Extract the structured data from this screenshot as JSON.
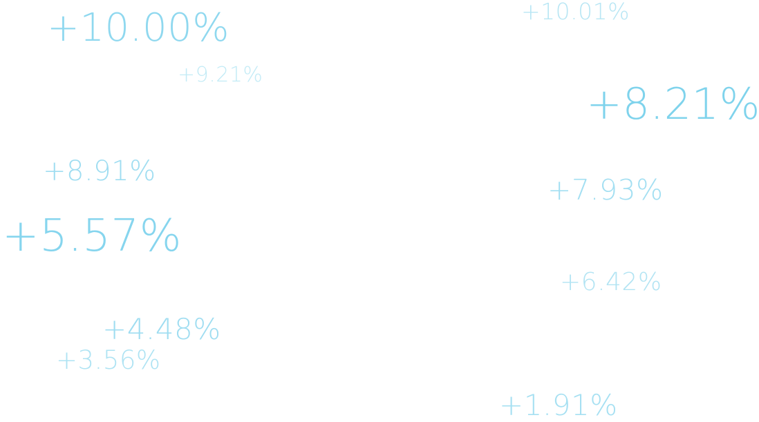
{
  "colors": {
    "text_primary": "#86d5ee",
    "text_light": "#b8e6f4",
    "background": "#ffffff"
  },
  "values": [
    "+10.00%",
    "+10.01%",
    "+9.21%",
    "+8.21%",
    "+8.91%",
    "+7.93%",
    "+5.57%",
    "+6.42%",
    "+4.48%",
    "+3.56%",
    "+1.91%"
  ]
}
